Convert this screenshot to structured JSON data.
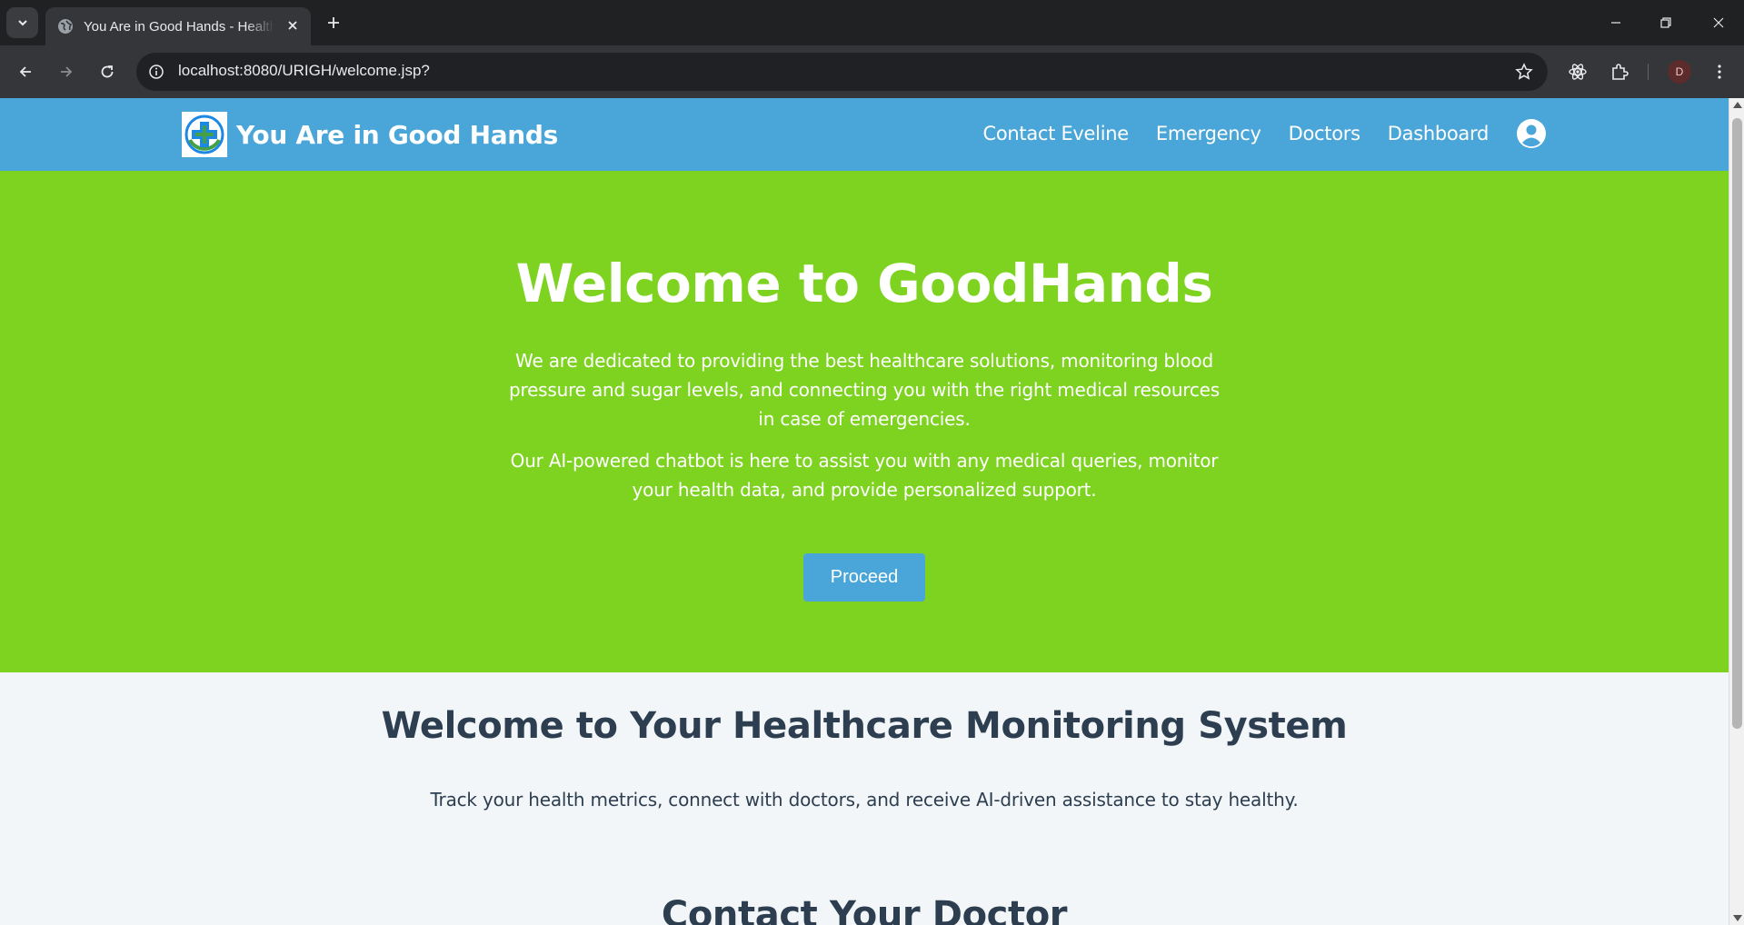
{
  "browser": {
    "tab_title": "You Are in Good Hands - Health",
    "url": "localhost:8080/URIGH/welcome.jsp?",
    "profile_initial": "D"
  },
  "site": {
    "brand_name": "You Are in Good Hands",
    "nav": [
      "Contact Eveline",
      "Emergency",
      "Doctors",
      "Dashboard"
    ]
  },
  "hero": {
    "title": "Welcome to GoodHands",
    "paragraph1": "We are dedicated to providing the best healthcare solutions, monitoring blood pressure and sugar levels, and connecting you with the right medical resources in case of emergencies.",
    "paragraph2": "Our AI-powered chatbot is here to assist you with any medical queries, monitor your health data, and provide personalized support.",
    "button_label": "Proceed"
  },
  "intro": {
    "title": "Welcome to Your Healthcare Monitoring System",
    "subtitle": "Track your health metrics, connect with doctors, and receive AI-driven assistance to stay healthy."
  },
  "contact": {
    "title": "Contact Your Doctor"
  },
  "colors": {
    "header": "#4aa6d9",
    "hero": "#7ed321",
    "heading_text": "#2c3e50",
    "page_bg": "#f3f6f9"
  }
}
